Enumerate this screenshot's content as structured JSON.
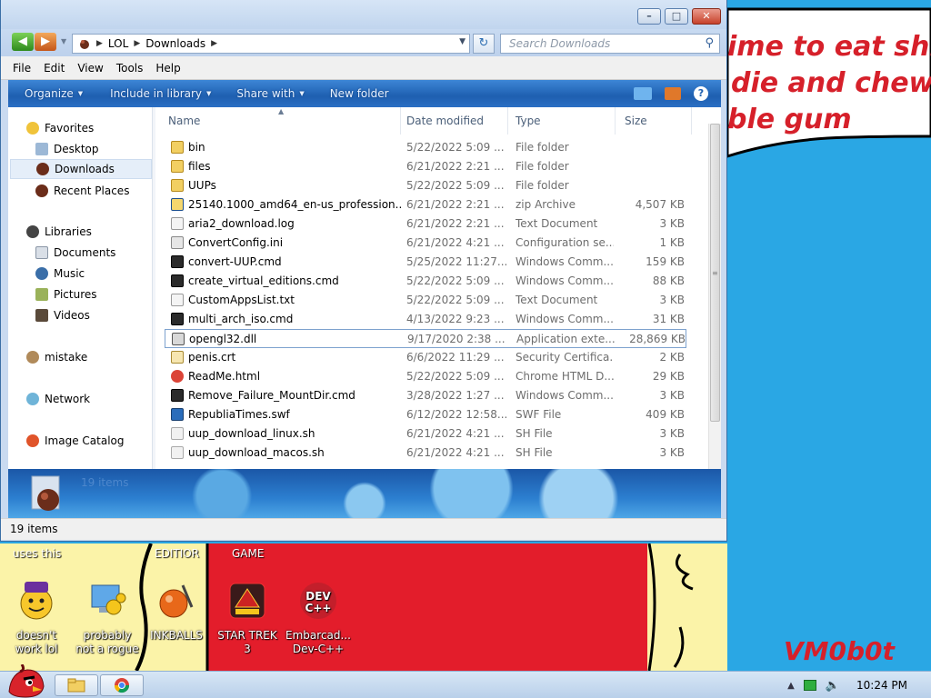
{
  "wallpaper": {
    "meme_lines": [
      "ime to eat shit",
      "die and chew",
      "ble gum"
    ],
    "captions": [
      "uses this",
      "EDITIOR",
      "GAME"
    ],
    "signature": "VM0b0t",
    "colors": {
      "sky": "#2aa7e4",
      "yellow": "#fbf3a8",
      "red": "#e31d2b",
      "text_red": "#d6202a"
    }
  },
  "desktop_icons": [
    {
      "label": "doesn't work lol",
      "icon": "yahoo-messenger-icon"
    },
    {
      "label": "probably not a rogue",
      "icon": "computer-gears-icon"
    },
    {
      "label": "INKBALLS",
      "icon": "inkball-icon"
    },
    {
      "label": "STAR TREK 3",
      "icon": "star-trek-game-icon"
    },
    {
      "label": "Embarcad... Dev-C++",
      "icon": "dev-cpp-icon"
    }
  ],
  "window": {
    "caption_buttons": {
      "minimize": "–",
      "maximize": "□",
      "close": "✕"
    },
    "breadcrumb": [
      "LOL",
      "Downloads"
    ],
    "search_placeholder": "Search Downloads",
    "menu": [
      "File",
      "Edit",
      "View",
      "Tools",
      "Help"
    ],
    "toolbar": {
      "organize": "Organize",
      "include_in_library": "Include in library",
      "share_with": "Share with",
      "new_folder": "New folder",
      "help": "?"
    },
    "nav_pane": {
      "favorites": "Favorites",
      "desktop": "Desktop",
      "downloads": "Downloads",
      "recent_places": "Recent Places",
      "libraries": "Libraries",
      "documents": "Documents",
      "music": "Music",
      "pictures": "Pictures",
      "videos": "Videos",
      "mistake": "mistake",
      "network": "Network",
      "image_catalog": "Image Catalog"
    },
    "columns": {
      "name": "Name",
      "date": "Date modified",
      "type": "Type",
      "size": "Size"
    },
    "files": [
      {
        "name": "bin",
        "date": "5/22/2022 5:09 ...",
        "type": "File folder",
        "size": "",
        "icon": "folder-icon"
      },
      {
        "name": "files",
        "date": "6/21/2022 2:21 ...",
        "type": "File folder",
        "size": "",
        "icon": "folder-icon"
      },
      {
        "name": "UUPs",
        "date": "5/22/2022 5:09 ...",
        "type": "File folder",
        "size": "",
        "icon": "folder-icon"
      },
      {
        "name": "25140.1000_amd64_en-us_profession...",
        "date": "6/21/2022 2:21 ...",
        "type": "zip Archive",
        "size": "4,507 KB",
        "icon": "zip-archive-icon"
      },
      {
        "name": "aria2_download.log",
        "date": "6/21/2022 2:21 ...",
        "type": "Text Document",
        "size": "3 KB",
        "icon": "text-file-icon"
      },
      {
        "name": "ConvertConfig.ini",
        "date": "6/21/2022 4:21 ...",
        "type": "Configuration se...",
        "size": "1 KB",
        "icon": "config-file-icon"
      },
      {
        "name": "convert-UUP.cmd",
        "date": "5/25/2022 11:27...",
        "type": "Windows Comm...",
        "size": "159 KB",
        "icon": "cmd-script-icon"
      },
      {
        "name": "create_virtual_editions.cmd",
        "date": "5/22/2022 5:09 ...",
        "type": "Windows Comm...",
        "size": "88 KB",
        "icon": "cmd-script-icon"
      },
      {
        "name": "CustomAppsList.txt",
        "date": "5/22/2022 5:09 ...",
        "type": "Text Document",
        "size": "3 KB",
        "icon": "text-file-icon"
      },
      {
        "name": "multi_arch_iso.cmd",
        "date": "4/13/2022 9:23 ...",
        "type": "Windows Comm...",
        "size": "31 KB",
        "icon": "cmd-script-icon"
      },
      {
        "name": "opengl32.dll",
        "date": "9/17/2020 2:38 ...",
        "type": "Application exte...",
        "size": "28,869 KB",
        "icon": "dll-file-icon",
        "selected": true
      },
      {
        "name": "penis.crt",
        "date": "6/6/2022 11:29 ...",
        "type": "Security Certifica...",
        "size": "2 KB",
        "icon": "certificate-icon"
      },
      {
        "name": "ReadMe.html",
        "date": "5/22/2022 5:09 ...",
        "type": "Chrome HTML D...",
        "size": "29 KB",
        "icon": "chrome-html-icon"
      },
      {
        "name": "Remove_Failure_MountDir.cmd",
        "date": "3/28/2022 1:27 ...",
        "type": "Windows Comm...",
        "size": "3 KB",
        "icon": "cmd-script-icon"
      },
      {
        "name": "RepubliaTimes.swf",
        "date": "6/12/2022 12:58...",
        "type": "SWF File",
        "size": "409 KB",
        "icon": "swf-file-icon"
      },
      {
        "name": "uup_download_linux.sh",
        "date": "6/21/2022 4:21 ...",
        "type": "SH File",
        "size": "3 KB",
        "icon": "sh-file-icon"
      },
      {
        "name": "uup_download_macos.sh",
        "date": "6/21/2022 4:21 ...",
        "type": "SH File",
        "size": "3 KB",
        "icon": "sh-file-icon"
      }
    ],
    "details_count": "19 items",
    "status_text": "19 items"
  },
  "taskbar": {
    "clock": "10:24 PM",
    "pinned": [
      "explorer-taskbar-button",
      "chrome-taskbar-button"
    ]
  }
}
